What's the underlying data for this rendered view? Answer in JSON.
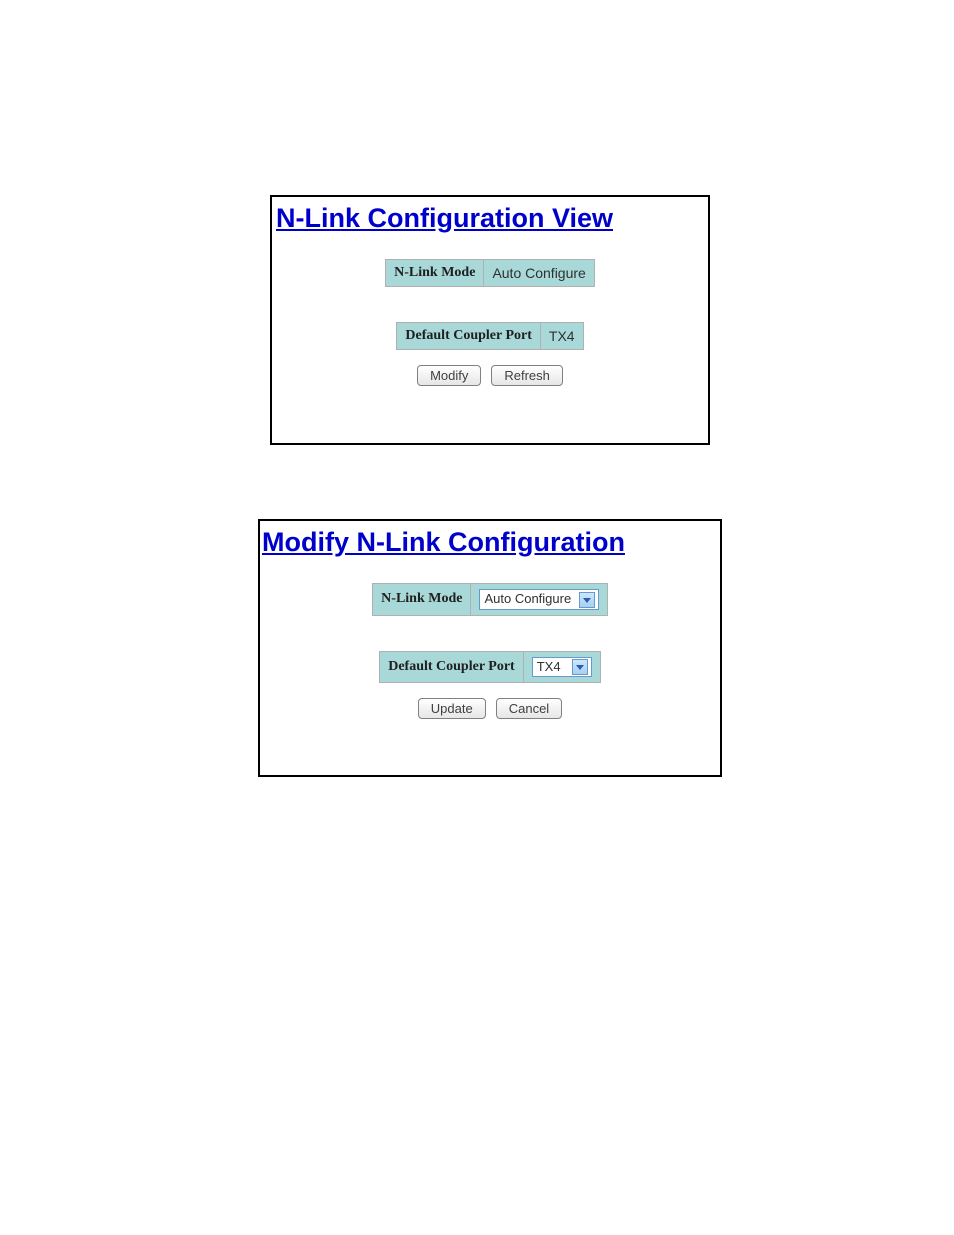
{
  "view_panel": {
    "title": "N-Link Configuration View",
    "nlink_mode_label": "N-Link Mode",
    "nlink_mode_value": "Auto Configure",
    "default_coupler_port_label": "Default Coupler Port",
    "default_coupler_port_value": "TX4",
    "modify_button": "Modify",
    "refresh_button": "Refresh"
  },
  "modify_panel": {
    "title": "Modify N-Link Configuration",
    "nlink_mode_label": "N-Link Mode",
    "nlink_mode_selected": "Auto Configure",
    "default_coupler_port_label": "Default Coupler Port",
    "default_coupler_port_selected": "TX4",
    "update_button": "Update",
    "cancel_button": "Cancel"
  }
}
